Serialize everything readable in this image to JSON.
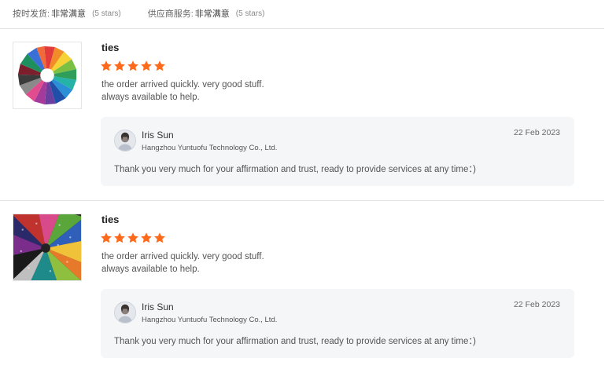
{
  "ratings": [
    {
      "label": "按时发货:",
      "value": "非常满意",
      "count": "(5 stars)"
    },
    {
      "label": "供应商服务:",
      "value": "非常满意",
      "count": "(5 stars)"
    }
  ],
  "reviews": [
    {
      "product_name": "ties",
      "stars": 5,
      "text_line1": "the order arrived quickly. very good stuff.",
      "text_line2": "always available to help.",
      "reply": {
        "seller_name": "Iris Sun",
        "company": "Hangzhou Yuntuofu Technology Co., Ltd.",
        "date": "22 Feb 2023",
        "text": "Thank you very much for your affirmation and trust, ready to provide services at any time：)"
      }
    },
    {
      "product_name": "ties",
      "stars": 5,
      "text_line1": "the order arrived quickly. very good stuff.",
      "text_line2": "always available to help.",
      "reply": {
        "seller_name": "Iris Sun",
        "company": "Hangzhou Yuntuofu Technology Co., Ltd.",
        "date": "22 Feb 2023",
        "text": "Thank you very much for your affirmation and trust, ready to provide services at any time：)"
      }
    }
  ],
  "colors": {
    "star": "#ff6a1a",
    "reply_bg": "#f5f6f8",
    "divider": "#e3e3e3"
  }
}
